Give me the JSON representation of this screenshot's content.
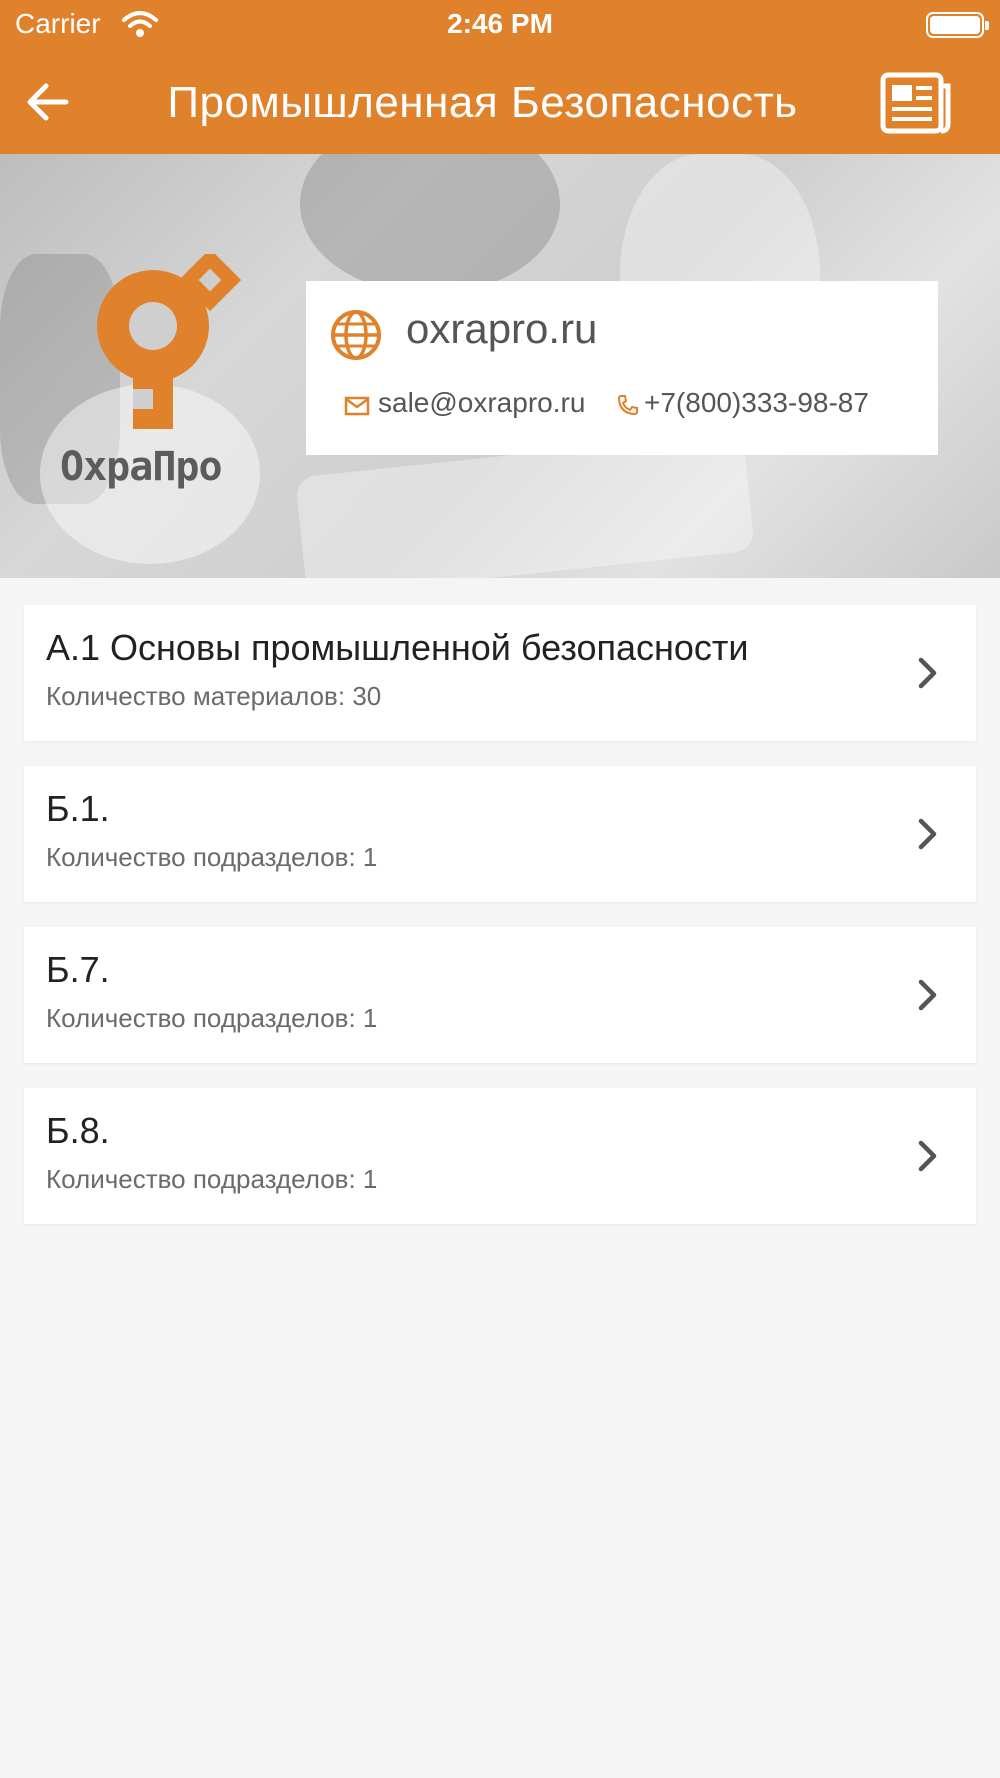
{
  "status_bar": {
    "carrier": "Carrier",
    "time": "2:46 PM"
  },
  "nav": {
    "title": "Промышленная Безопасность",
    "back_icon": "arrow-left-icon",
    "right_icon": "newspaper-icon"
  },
  "banner": {
    "logo_text": "ОхраПро",
    "website": "oxrapro.ru",
    "email": "sale@oxrapro.ru",
    "phone": "+7(800)333-98-87"
  },
  "sections": [
    {
      "title": "А.1 Основы промышленной безопасности",
      "subtitle": "Количество материалов: 30"
    },
    {
      "title": "Б.1.",
      "subtitle": "Количество подразделов: 1"
    },
    {
      "title": "Б.7.",
      "subtitle": "Количество подразделов: 1"
    },
    {
      "title": "Б.8.",
      "subtitle": "Количество подразделов: 1"
    }
  ],
  "colors": {
    "accent": "#e0812b",
    "background": "#f5f5f5"
  }
}
